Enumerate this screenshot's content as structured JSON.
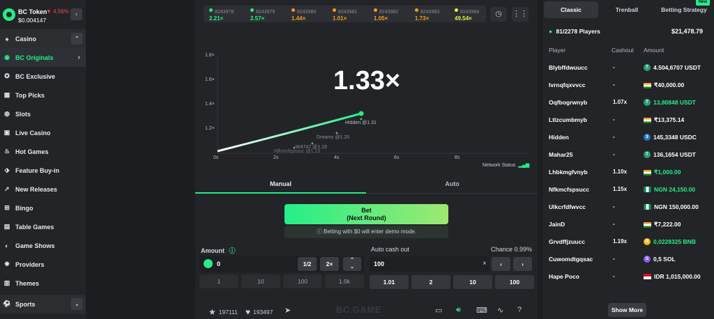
{
  "token": {
    "name": "BC Token",
    "change": "▼ 4.56%",
    "price": "$0.004147"
  },
  "sidebar": {
    "items": [
      {
        "label": "Casino",
        "icon": "casino-icon"
      },
      {
        "label": "BC Originals",
        "icon": "bc-originals-icon"
      },
      {
        "label": "BC Exclusive",
        "icon": "bc-exclusive-icon"
      },
      {
        "label": "Top Picks",
        "icon": "top-picks-icon"
      },
      {
        "label": "Slots",
        "icon": "slots-icon"
      },
      {
        "label": "Live Casino",
        "icon": "live-casino-icon"
      },
      {
        "label": "Hot Games",
        "icon": "fire-icon"
      },
      {
        "label": "Feature Buy-in",
        "icon": "feature-buy-icon"
      },
      {
        "label": "New Releases",
        "icon": "rocket-icon"
      },
      {
        "label": "Bingo",
        "icon": "bingo-icon"
      },
      {
        "label": "Table Games",
        "icon": "table-games-icon"
      },
      {
        "label": "Game Shows",
        "icon": "game-shows-icon"
      },
      {
        "label": "Providers",
        "icon": "providers-icon"
      },
      {
        "label": "Themes",
        "icon": "themes-icon"
      },
      {
        "label": "Sports",
        "icon": "sports-icon"
      }
    ]
  },
  "history": [
    {
      "id": "8243978",
      "mult": "2.21×",
      "color": "#24ee89"
    },
    {
      "id": "8243979",
      "mult": "2.57×",
      "color": "#24ee89"
    },
    {
      "id": "8243980",
      "mult": "1.44×",
      "color": "#f49b1f"
    },
    {
      "id": "8243981",
      "mult": "1.01×",
      "color": "#f49b1f"
    },
    {
      "id": "8243982",
      "mult": "1.05×",
      "color": "#f49b1f"
    },
    {
      "id": "8243983",
      "mult": "1.73×",
      "color": "#f49b1f"
    },
    {
      "id": "8243984",
      "mult": "49.54×",
      "color": "#e5f23a"
    }
  ],
  "game": {
    "multiplier": "1.33×",
    "y_ticks": [
      "1.8×",
      "1.6×",
      "1.4×",
      "1.2×"
    ],
    "x_ticks": [
      "0s",
      "2s",
      "4s",
      "6s",
      "8s"
    ],
    "cashouts": [
      {
        "label": "Hidden @1.31"
      },
      {
        "label": "Dreams @1.25"
      },
      {
        "label": "W4747 @1.19"
      },
      {
        "label": "Nfkmcfspsucc @1.15"
      }
    ],
    "network_status": "Network Status"
  },
  "tabs": {
    "manual": "Manual",
    "auto": "Auto"
  },
  "bet": {
    "line1": "Bet",
    "line2": "(Next Round)",
    "demo_notice": "Betting with $0 will enter demo mode."
  },
  "amount": {
    "label": "Amount",
    "value": "0",
    "half": "1/2",
    "double": "2×",
    "quick": [
      "1",
      "10",
      "100",
      "1.0k"
    ]
  },
  "cashout": {
    "label": "Auto cash out",
    "chance": "Chance 0.99%",
    "value": "100",
    "clear": "×",
    "quick": [
      "1.01",
      "2",
      "10",
      "100"
    ]
  },
  "bottom": {
    "stars": "197111",
    "likes": "193497",
    "watermark": "BC.GAME"
  },
  "panel": {
    "tabs": [
      "Classic",
      "Trenball",
      "Betting Strategy"
    ],
    "new_badge": "New",
    "players": "81/2278 Players",
    "total": "$21,478.79",
    "columns": [
      "Player",
      "Cashout",
      "Amount"
    ],
    "rows": [
      {
        "player": "Blybffdwuucc",
        "cashout": "-",
        "amount": "4.504,6707 USDT",
        "cur": "usdt",
        "win": false
      },
      {
        "player": "Ivrnqfqxvvcc",
        "cashout": "-",
        "amount": "₹40,000.00",
        "cur": "inr",
        "win": false
      },
      {
        "player": "Oqfbogrwnyb",
        "cashout": "1.07x",
        "amount": "13,80848 USDT",
        "cur": "usdt",
        "win": true
      },
      {
        "player": "Ltlzcumbmyb",
        "cashout": "-",
        "amount": "₹13,375.14",
        "cur": "inr",
        "win": false
      },
      {
        "player": "Hidden",
        "cashout": "-",
        "amount": "145,3348 USDC",
        "cur": "usdc",
        "win": false
      },
      {
        "player": "Mahar25",
        "cashout": "-",
        "amount": "136,1654 USDT",
        "cur": "usdt",
        "win": false
      },
      {
        "player": "Lhbkmgfvnyb",
        "cashout": "1.10x",
        "amount": "₹1,000.00",
        "cur": "inr",
        "win": true
      },
      {
        "player": "Nfkmcfspsucc",
        "cashout": "1.15x",
        "amount": "NGN 24,150.00",
        "cur": "ngn",
        "win": true
      },
      {
        "player": "Ulkcrfdfwvcc",
        "cashout": "-",
        "amount": "NGN 150,000.00",
        "cur": "ngn",
        "win": false
      },
      {
        "player": "JainD",
        "cashout": "-",
        "amount": "₹7,222.00",
        "cur": "inr",
        "win": false
      },
      {
        "player": "Grvdffjzuucc",
        "cashout": "1.19x",
        "amount": "0,0228325 BNB",
        "cur": "bnb",
        "win": true
      },
      {
        "player": "Cuwomdtgqsac",
        "cashout": "-",
        "amount": "0,5 SOL",
        "cur": "sol",
        "win": false
      },
      {
        "player": "Hape Poco",
        "cashout": "-",
        "amount": "IDR 1,015,000.00",
        "cur": "idr",
        "win": false
      }
    ],
    "show_more": "Show More"
  }
}
